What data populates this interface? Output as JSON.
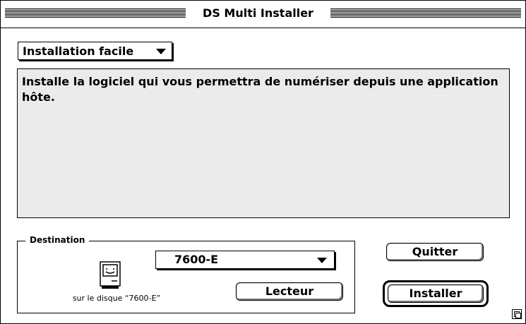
{
  "window": {
    "title": "DS Multi Installer"
  },
  "install_type": {
    "selected": "Installation facile"
  },
  "description": {
    "text": "Installe la logiciel qui vous permettra de numériser depuis une application hôte."
  },
  "destination": {
    "group_label": "Destination",
    "disk_caption": "sur le disque “7600-E”",
    "selected_disk": "7600-E",
    "icon": "mac-computer-icon"
  },
  "buttons": {
    "lecteur": "Lecteur",
    "quitter": "Quitter",
    "installer": "Installer"
  }
}
